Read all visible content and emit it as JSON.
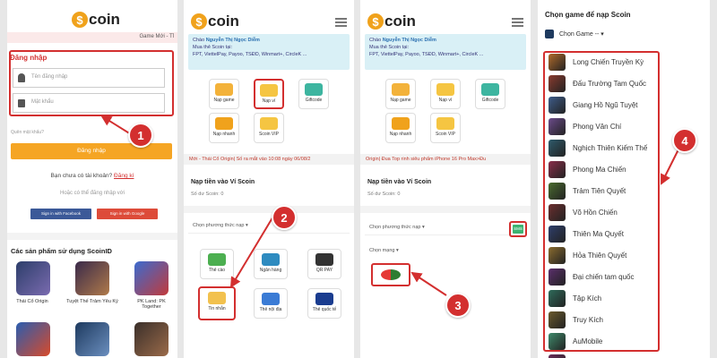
{
  "logo_text": "coin",
  "panel1": {
    "notice": "Game Mới - Tỉ",
    "login_title": "Đăng nhập",
    "username_placeholder": "Tên đăng nhập",
    "password_placeholder": "Mật khẩu",
    "forgot": "Quên mật khẩu?",
    "login_button": "Đăng nhập",
    "no_account": "Bạn chưa có tài khoản?",
    "register": "Đăng kí",
    "or_login": "Hoặc có thể đăng nhập với",
    "facebook": "Sign in with Facebook",
    "google": "Sign in with Google",
    "products_title": "Các sản phẩm sử dụng ScoinID",
    "products": [
      "Thái Cổ Origin",
      "Tuyệt Thế Trảm Yêu Ký",
      "PK Land: PK Together"
    ]
  },
  "panel2": {
    "greeting_line1": "Chào",
    "user_name": "Nguyễn Thị Ngọc Diễm",
    "greeting_line2": "Mua thẻ Scoin tại:",
    "greeting_line3": "FPT, ViettelPay, Payoo, TSĐD, Winmart+, CircleK ...",
    "tiles": [
      "Nạp game",
      "Nạp ví",
      "Giftcode",
      "Nạp nhanh",
      "Scoin VIP"
    ],
    "banner": "Mới - Thái Cổ Origin| Số ra mắt vào 10:08 ngày 06/08/2",
    "wallet_title": "Nạp tiền vào Ví Scoin",
    "balance": "Số dư Scoin: 0",
    "method_label": "Chọn phương thức nạp",
    "methods": [
      "Thẻ cào",
      "Ngân hàng",
      "QR PAY",
      "Tin nhắn",
      "Thẻ nội địa",
      "Thẻ quốc tế"
    ]
  },
  "panel3": {
    "banner": "Origin| Đua Top rinh siêu phẩm iPhone 16 Pro Max>Đu",
    "method_label": "Chọn phương thức nạp",
    "sms_label": "SMS",
    "network_label": "Chọn mạng"
  },
  "panel4": {
    "title": "Chọn game để nạp Scoin",
    "select_label": "Chọn Game --",
    "games": [
      "Long Chiến Truyền Kỳ",
      "Đấu Trường Tam Quốc",
      "Giang Hồ Ngũ Tuyệt",
      "Phong Vân Chí",
      "Nghịch Thiên Kiếm Thế",
      "Phong Ma Chiến",
      "Trảm Tiên Quyết",
      "Võ Hồn Chiến",
      "Thiên Ma Quyết",
      "Hỏa Thiên Quyết",
      "Đại chiến tam quốc",
      "Tập Kích",
      "Truy Kích",
      "AuMobile",
      "Ma Kiếm Sinh Tử Ký"
    ]
  },
  "badges": [
    "1",
    "2",
    "3",
    "4"
  ],
  "colors": {
    "accent": "#d32f2f",
    "orange": "#f5a524",
    "facebook": "#3b5998",
    "google": "#dd4b39",
    "info_bg": "#d9f0f6"
  }
}
